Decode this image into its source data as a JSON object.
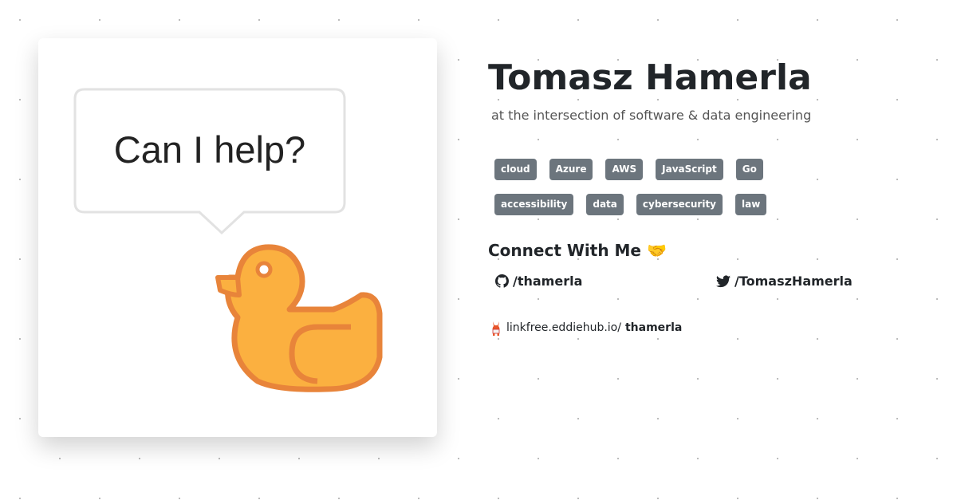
{
  "profile": {
    "name": "Tomasz Hamerla",
    "tagline": "at the intersection of software & data engineering"
  },
  "image": {
    "bubble_text": "Can I help?"
  },
  "tags": {
    "row1": [
      "cloud",
      "Azure",
      "AWS",
      "JavaScript",
      "Go"
    ],
    "row2": [
      "accessibility",
      "data",
      "cybersecurity",
      "law"
    ]
  },
  "connect": {
    "heading": "Connect With Me",
    "emoji": "🤝",
    "github": "/thamerla",
    "twitter": "/TomaszHamerla",
    "linkfree_prefix": "linkfree.eddiehub.io/",
    "linkfree_user": "thamerla"
  },
  "colors": {
    "tag_bg": "#6c757d",
    "duck_fill": "#fbb040",
    "duck_outline": "#e8843a"
  }
}
